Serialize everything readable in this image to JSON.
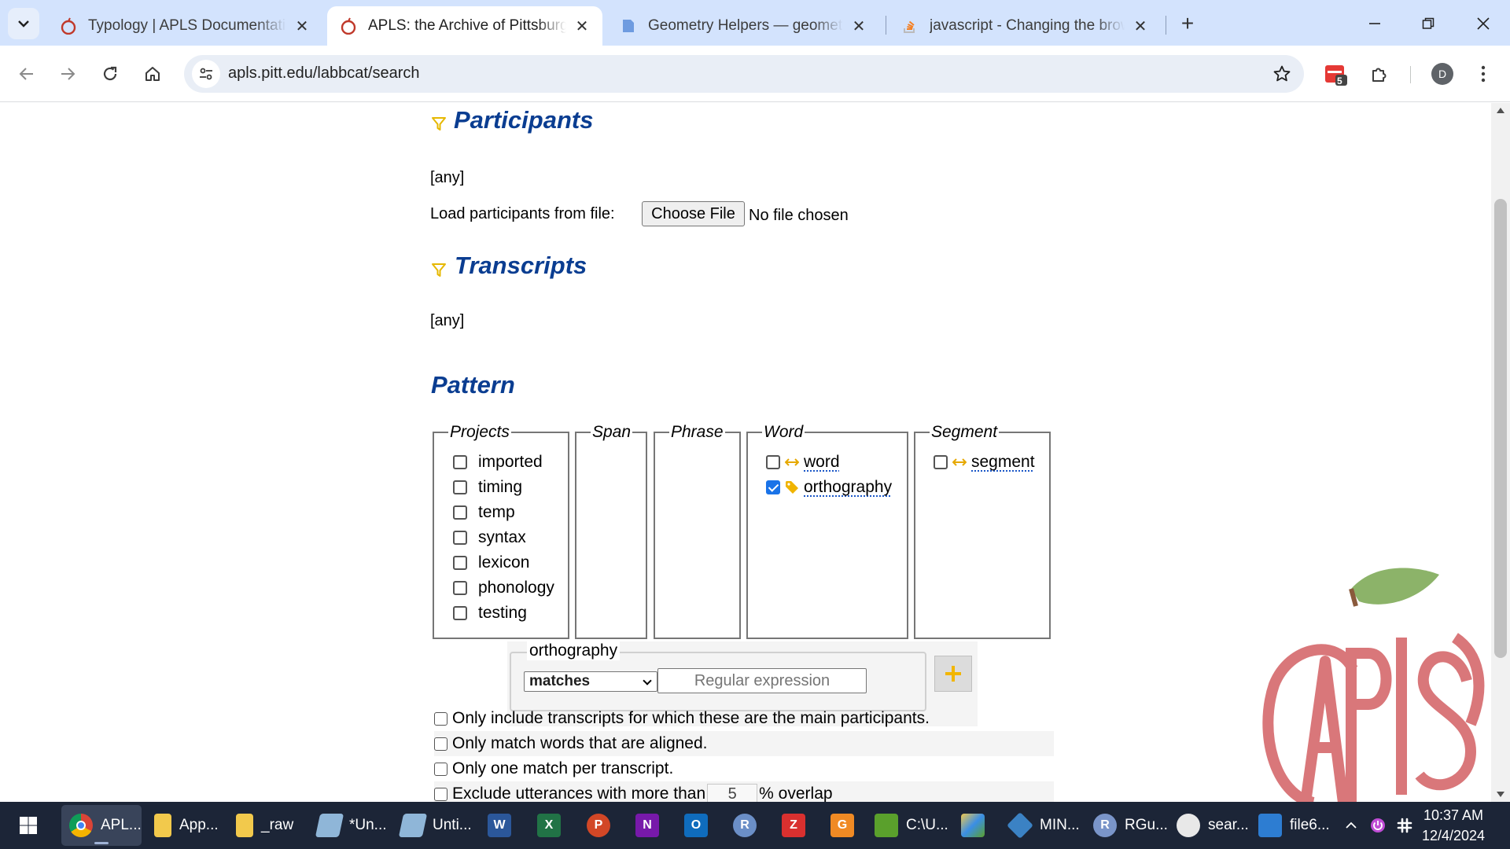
{
  "browser": {
    "tabs": [
      {
        "title": "Typology | APLS Documentation",
        "active": false
      },
      {
        "title": "APLS: the Archive of Pittsburgh",
        "active": true
      },
      {
        "title": "Geometry Helpers — geometry",
        "active": false
      },
      {
        "title": "javascript - Changing the brows",
        "active": false
      }
    ],
    "url": "apls.pitt.edu/labbcat/search",
    "profile_initial": "D",
    "extension_badge": "5"
  },
  "page": {
    "participants": {
      "heading": "Participants",
      "value": "[any]",
      "load_label": "Load participants from file:",
      "choose_button": "Choose File",
      "no_file": "No file chosen"
    },
    "transcripts": {
      "heading": "Transcripts",
      "value": "[any]"
    },
    "pattern": {
      "heading": "Pattern",
      "groups": {
        "projects": {
          "legend": "Projects",
          "items": [
            {
              "label": "imported",
              "checked": false
            },
            {
              "label": "timing",
              "checked": false
            },
            {
              "label": "temp",
              "checked": false
            },
            {
              "label": "syntax",
              "checked": false
            },
            {
              "label": "lexicon",
              "checked": false
            },
            {
              "label": "phonology",
              "checked": false
            },
            {
              "label": "testing",
              "checked": false
            }
          ]
        },
        "span": {
          "legend": "Span"
        },
        "phrase": {
          "legend": "Phrase"
        },
        "word": {
          "legend": "Word",
          "items": [
            {
              "label": "word",
              "checked": false,
              "icon": "alignment-arrows-icon"
            },
            {
              "label": "orthography",
              "checked": true,
              "icon": "tag-icon"
            }
          ]
        },
        "segment": {
          "legend": "Segment",
          "items": [
            {
              "label": "segment",
              "checked": false,
              "icon": "alignment-arrows-icon"
            }
          ]
        }
      },
      "matcher": {
        "legend": "orthography",
        "operator": "matches",
        "placeholder": "Regular expression"
      }
    },
    "options": [
      {
        "label": "Only include transcripts for which these are the main participants.",
        "checked": false
      },
      {
        "label": "Only match words that are aligned.",
        "checked": false
      },
      {
        "label": "Only one match per transcript.",
        "checked": false
      }
    ],
    "overlap": {
      "before": "Exclude utterances with more than",
      "value": "5",
      "after": "% overlap"
    }
  },
  "taskbar": {
    "items": [
      {
        "label": "APL...",
        "color": "#ffffff"
      },
      {
        "label": "App...",
        "color": "#f2c94c"
      },
      {
        "label": "_raw",
        "color": "#f2c94c"
      },
      {
        "label": "*Un...",
        "color": "#8fb6d8"
      },
      {
        "label": "Unti...",
        "color": "#8fb6d8"
      },
      {
        "label": "",
        "color": "#2b579a",
        "glyph": "W"
      },
      {
        "label": "",
        "color": "#217346",
        "glyph": "X"
      },
      {
        "label": "",
        "color": "#d24726",
        "glyph": "P"
      },
      {
        "label": "",
        "color": "#7719aa",
        "glyph": "N"
      },
      {
        "label": "",
        "color": "#0f6cbd",
        "glyph": "O"
      },
      {
        "label": "",
        "color": "#6b8fc7",
        "glyph": "R"
      },
      {
        "label": "",
        "color": "#d9302f",
        "glyph": "Z"
      },
      {
        "label": "",
        "color": "#f08a24",
        "glyph": "G"
      },
      {
        "label": "C:\\U...",
        "color": "#5aa02c"
      },
      {
        "label": "",
        "color": "#3a8ee6"
      },
      {
        "label": "MIN...",
        "color": "#3b82c4"
      },
      {
        "label": "RGu...",
        "color": "#7a95c9",
        "glyph": "R"
      },
      {
        "label": "sear...",
        "color": "#e8e8e8"
      },
      {
        "label": "file6...",
        "color": "#2d7dd2"
      }
    ],
    "time": "10:37 AM",
    "date": "12/4/2024"
  },
  "colors": {
    "heading": "#0a3d91",
    "filter_icon": "#e6b800",
    "logo": "#d9777a",
    "leaf": "#8cb369"
  }
}
